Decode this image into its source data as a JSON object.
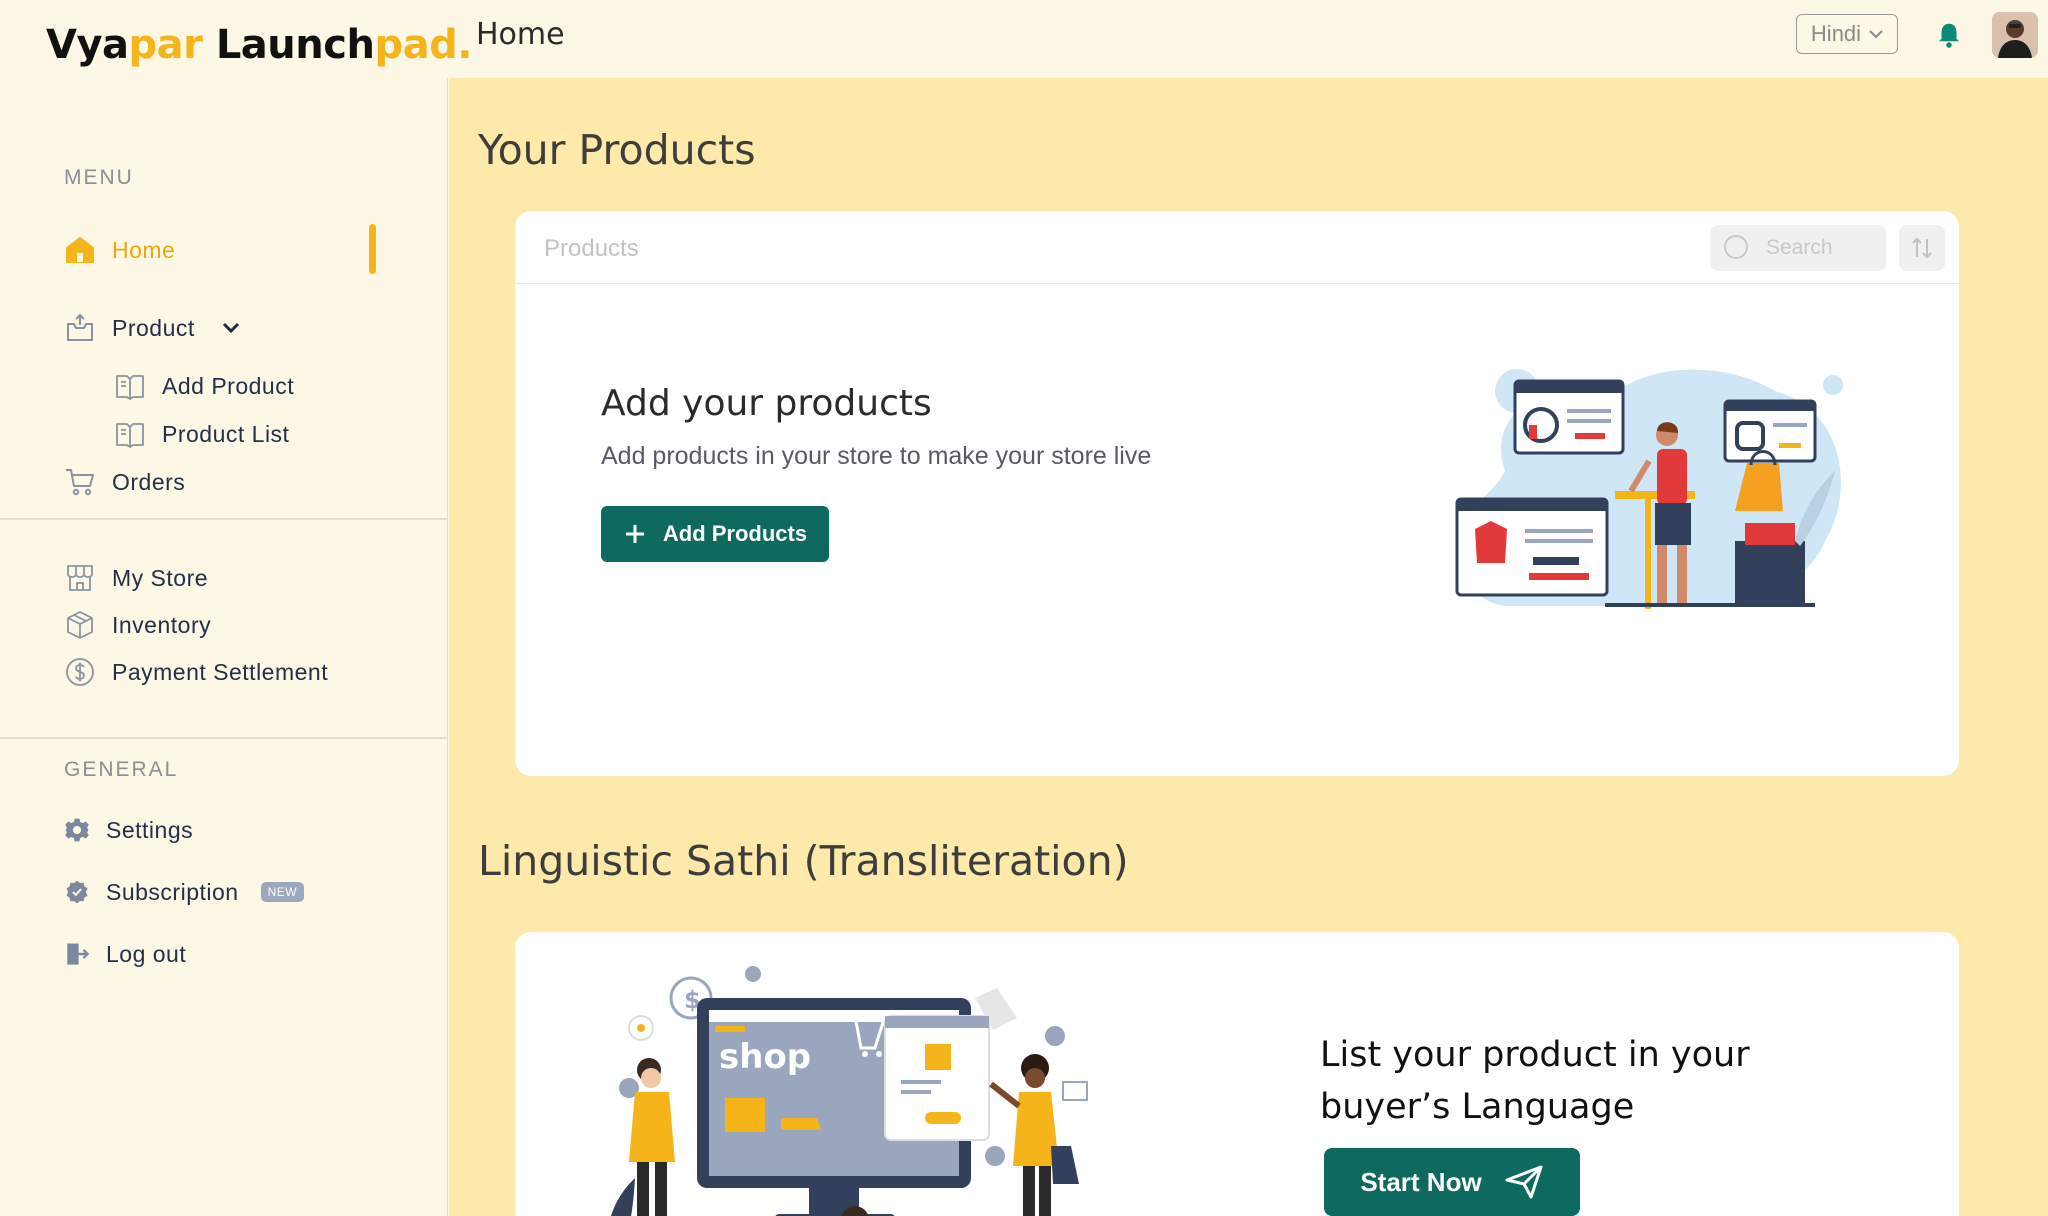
{
  "header": {
    "logo_part1": "Vya",
    "logo_part2": "par",
    "logo_part3": " Launch",
    "logo_part4": "pad.",
    "page_title": "Home",
    "language_select_value": "Hindi",
    "notification_icon": "bell-icon",
    "avatar_icon": "user-avatar"
  },
  "sidebar": {
    "menu_label": "MENU",
    "items": [
      {
        "label": "Home",
        "icon": "home-icon",
        "active": true
      },
      {
        "label": "Product",
        "icon": "box-icon",
        "expanded": true
      },
      {
        "label": "Add Product",
        "icon": "book-icon"
      },
      {
        "label": "Product List",
        "icon": "book-icon"
      },
      {
        "label": "Orders",
        "icon": "cart-icon"
      },
      {
        "label": "My Store",
        "icon": "store-icon"
      },
      {
        "label": "Inventory",
        "icon": "package-icon"
      },
      {
        "label": "Payment Settlement",
        "icon": "dollar-icon"
      }
    ],
    "general_label": "GENERAL",
    "general_items": [
      {
        "label": "Settings",
        "icon": "gear-icon"
      },
      {
        "label": "Subscription",
        "icon": "badge-icon",
        "badge": "NEW"
      },
      {
        "label": "Log out",
        "icon": "logout-icon"
      }
    ]
  },
  "main": {
    "products_heading": "Your Products",
    "products_card": {
      "header_title": "Products",
      "search_placeholder": "Search",
      "empty_title": "Add your products",
      "empty_description": "Add products in your store to make your store live",
      "add_button_label": "Add Products"
    },
    "linguistic_heading": "Linguistic Sathi (Transliteration)",
    "linguistic_card": {
      "title": "List your product in your buyer’s Language",
      "start_button_label": "Start Now",
      "illustration_text": "shop"
    }
  },
  "colors": {
    "accent": "#f4b41a",
    "primary_button": "#0e6a5e",
    "main_bg": "#fde9a9",
    "sidebar_bg": "#fdf8e6"
  }
}
